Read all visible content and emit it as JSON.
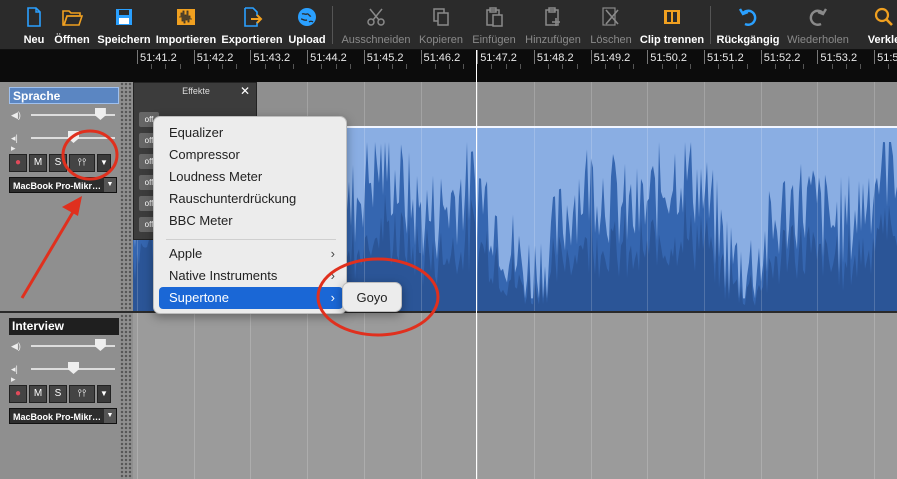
{
  "toolbar": {
    "buttons": [
      {
        "label": "Neu",
        "enabled": true,
        "icon": "new-file-icon"
      },
      {
        "label": "Öffnen",
        "enabled": true,
        "icon": "folder-open-icon"
      },
      {
        "label": "Speichern",
        "enabled": true,
        "icon": "save-icon"
      },
      {
        "label": "Importieren",
        "enabled": true,
        "icon": "import-audio-icon"
      },
      {
        "label": "Exportieren",
        "enabled": true,
        "icon": "export-icon"
      },
      {
        "label": "Upload",
        "enabled": true,
        "icon": "globe-icon"
      },
      {
        "label": "Ausschneiden",
        "enabled": false,
        "icon": "scissors-icon"
      },
      {
        "label": "Kopieren",
        "enabled": false,
        "icon": "copy-icon"
      },
      {
        "label": "Einfügen",
        "enabled": false,
        "icon": "paste-icon"
      },
      {
        "label": "Hinzufügen",
        "enabled": false,
        "icon": "add-clip-icon"
      },
      {
        "label": "Löschen",
        "enabled": false,
        "icon": "delete-icon"
      },
      {
        "label": "Clip trennen",
        "enabled": true,
        "icon": "split-clip-icon"
      },
      {
        "label": "Rückgängig",
        "enabled": true,
        "icon": "undo-icon"
      },
      {
        "label": "Wiederholen",
        "enabled": false,
        "icon": "redo-icon"
      },
      {
        "label": "Verkle",
        "enabled": true,
        "icon": "zoom-icon"
      }
    ]
  },
  "ruler": {
    "labels": [
      "51:41.2",
      "51:42.2",
      "51:43.2",
      "51:44.2",
      "51:45.2",
      "51:46.2",
      "51:47.2",
      "51:48.2",
      "51:49.2",
      "51:50.2",
      "51:51.2",
      "51:52.2",
      "51:53.2",
      "51:5"
    ]
  },
  "tracks": [
    {
      "name": "Sprache",
      "selected": true,
      "volume_level": 0.82,
      "pan_level": 0.5,
      "buttons": [
        "●",
        "M",
        "S",
        "⫯⫯"
      ],
      "device": "MacBook Pro-Mikr…"
    },
    {
      "name": "Interview",
      "selected": false,
      "volume_level": 0.82,
      "pan_level": 0.5,
      "buttons": [
        "●",
        "M",
        "S",
        "⫯⫯"
      ],
      "device": "MacBook Pro-Mikr…"
    }
  ],
  "effects_panel": {
    "title": "Effekte",
    "close": "✕",
    "slots": [
      "off",
      "off",
      "off",
      "off",
      "off",
      "off"
    ]
  },
  "context_menu": {
    "items": [
      {
        "label": "Equalizer"
      },
      {
        "label": "Compressor"
      },
      {
        "label": "Loudness Meter"
      },
      {
        "label": "Rauschunterdrückung"
      },
      {
        "label": "BBC Meter"
      }
    ],
    "submenus": [
      {
        "label": "Apple",
        "chevron": "›"
      },
      {
        "label": "Native Instruments",
        "chevron": "›"
      },
      {
        "label": "Supertone",
        "chevron": "›",
        "highlighted": true
      }
    ],
    "supertone_submenu": {
      "label": "Goyo"
    }
  },
  "colors": {
    "waveform_bg": "#8aaee3",
    "waveform_fg": "#3566b0",
    "waveform_dark": "#2b5597",
    "selected_track": "#5b86c2",
    "menu_highlight": "#1a67d6",
    "annotation_red": "#e0301e"
  }
}
